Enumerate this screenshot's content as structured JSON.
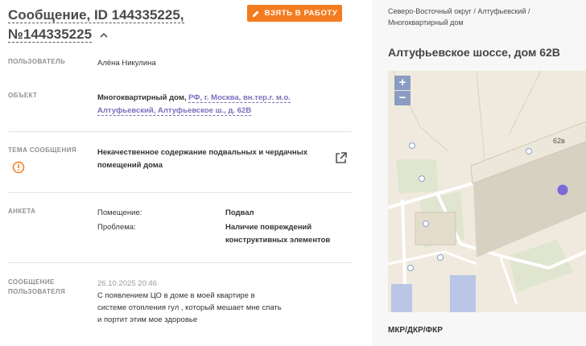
{
  "message": {
    "title_line1": "Сообщение, ID 144335225,",
    "title_line2": "№144335225",
    "take_button": "ВЗЯТЬ В РАБОТУ"
  },
  "fields": {
    "user_label": "ПОЛЬЗОВАТЕЛЬ",
    "user_value": "Алёна Никулина",
    "object_label": "ОБЪЕКТ",
    "object_type": "Многоквартирный дом",
    "object_link": "РФ, г. Москва, вн.тер.г. м.о. Алтуфьевский, Алтуфьевское ш., д. 62В",
    "topic_label": "ТЕМА СООБЩЕНИЯ",
    "topic_value": "Некачественное содержание подвальных и чердачных помещений дома",
    "survey_label": "АНКЕТА",
    "survey_q1": "Помещение:",
    "survey_a1": "Подвал",
    "survey_q2": "Проблема:",
    "survey_a2": "Наличие повреждений конструктивных элементов",
    "msg_label_line1": "СООБЩЕНИЕ",
    "msg_label_line2": "ПОЛЬЗОВАТЕЛЯ",
    "msg_date": "26.10.2025 20:46",
    "msg_text": "С появлением ЦО в доме в моей квартире в системе отопления гул , который мешает мне спать и портит этим мое здоровье"
  },
  "sidebar": {
    "breadcrumb": "Северо-Восточный округ / Алтуфьевский / Многоквартирный дом",
    "address": "Алтуфьевское шоссе, дом 62В",
    "map_building_label": "62в",
    "zoom_in": "+",
    "zoom_out": "−",
    "bottom_label": "МКР/ДКР/ФКР"
  },
  "colors": {
    "accent": "#f47c20",
    "link": "#7a6fbf",
    "marker": "#7b68d9"
  }
}
